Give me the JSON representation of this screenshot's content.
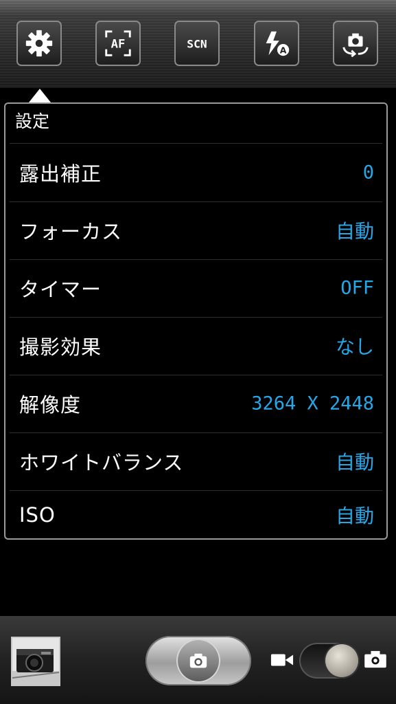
{
  "toolbar": {
    "buttons": [
      {
        "name": "settings",
        "icon": "gear-icon"
      },
      {
        "name": "af",
        "icon": "af-focus-icon",
        "glyph": "AF"
      },
      {
        "name": "scn",
        "icon": "scene-mode-icon",
        "glyph": "SCN"
      },
      {
        "name": "flash",
        "icon": "flash-auto-icon",
        "glyph": "A"
      },
      {
        "name": "switch-camera",
        "icon": "switch-camera-icon"
      }
    ]
  },
  "settings_panel": {
    "title": "設定",
    "rows": [
      {
        "label": "露出補正",
        "value": "0"
      },
      {
        "label": "フォーカス",
        "value": "自動"
      },
      {
        "label": "タイマー",
        "value": "OFF"
      },
      {
        "label": "撮影効果",
        "value": "なし"
      },
      {
        "label": "解像度",
        "value": "3264 X 2448"
      },
      {
        "label": "ホワイトバランス",
        "value": "自動"
      },
      {
        "label": "ISO",
        "value": "自動"
      }
    ]
  },
  "bottom": {
    "thumbnail": "last-photo-thumbnail",
    "shutter": "camera-shutter-icon",
    "mode_toggle": {
      "left_icon": "video-icon",
      "right_icon": "camera-icon",
      "selected": "camera"
    }
  },
  "colors": {
    "value_text": "#27a6e8",
    "label_text": "#ffffff",
    "panel_border": "#9a9a9a"
  }
}
